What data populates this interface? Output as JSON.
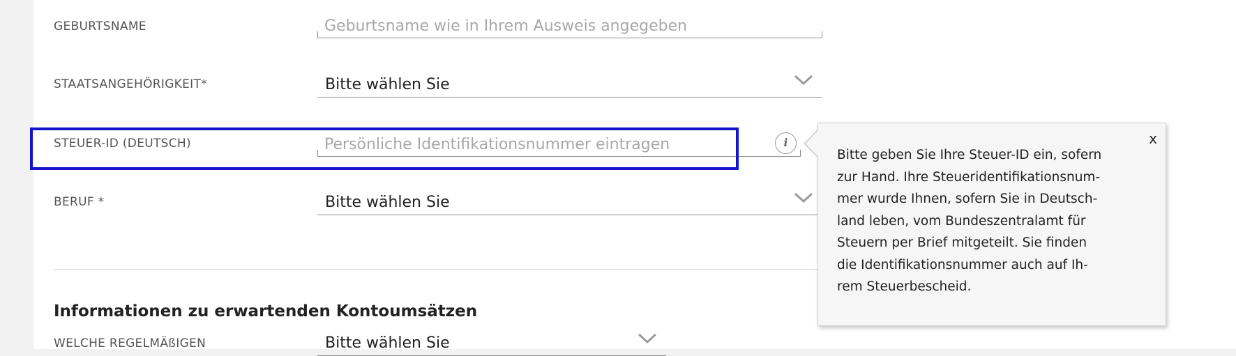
{
  "form": {
    "birth_name": {
      "label": "GEBURTSNAME",
      "placeholder": "Geburtsname wie in Ihrem Ausweis angegeben"
    },
    "nationality": {
      "label": "STAATSANGEHÖRIGKEIT*",
      "value": "Bitte wählen Sie"
    },
    "tax_id": {
      "label": "STEUER-ID (DEUTSCH)",
      "placeholder": "Persönliche Identifikationsnummer eintragen",
      "info_icon_symbol": "i"
    },
    "occupation": {
      "label": "BERUF *",
      "value": "Bitte wählen Sie"
    },
    "section_title": "Informationen zu erwartenden Kontoumsätzen",
    "regular": {
      "label": "WELCHE REGELMÄßIGEN",
      "value": "Bitte wählen Sie"
    }
  },
  "tooltip": {
    "close_label": "x",
    "lines": [
      "Bitte geben Sie Ihre Steuer-ID ein, sofern",
      "zur Hand. Ihre Steueridentifikationsnum-",
      "mer wurde Ihnen, sofern Sie in Deutsch-",
      "land leben, vom Bundeszentralamt für",
      "Steuern per Brief mitgeteilt. Sie finden",
      "die Identifikationsnummer auch auf Ih-",
      "rem Steuerbescheid."
    ]
  },
  "colors": {
    "highlight_border": "#1414c8",
    "label_text": "#555555",
    "field_line": "#8c8c8c",
    "placeholder": "#a8a8a8"
  }
}
